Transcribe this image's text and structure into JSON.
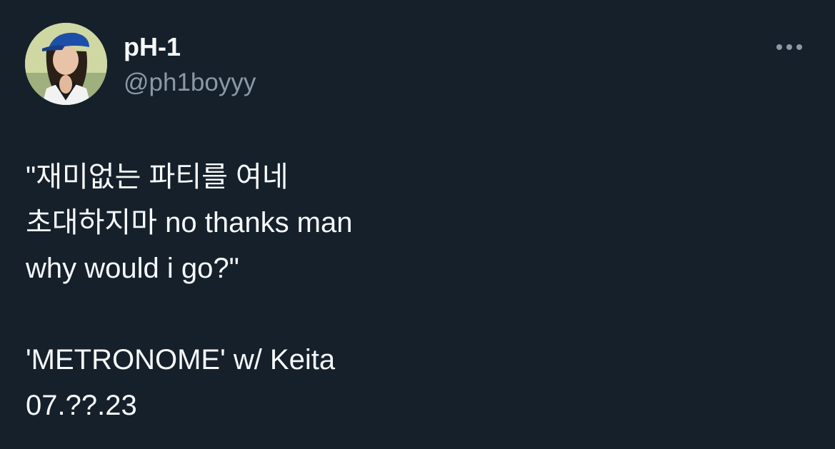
{
  "author": {
    "display_name": "pH-1",
    "handle": "@ph1boyyy",
    "avatar_icon": "profile-photo"
  },
  "more_icon": "ellipsis-icon",
  "tweet": {
    "lines": [
      "\"재미없는 파티를 여네",
      "초대하지마 no thanks man",
      "why would i go?\"",
      "",
      "'METRONOME' w/ Keita",
      "07.??.23"
    ]
  },
  "colors": {
    "background": "#15202b",
    "primary_text": "#f7f9f9",
    "secondary_text": "#8b98a5"
  }
}
